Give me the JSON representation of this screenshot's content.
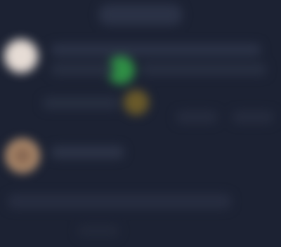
{
  "header": {
    "title": ""
  },
  "items": [
    {
      "name": "",
      "preview": "",
      "meta": ""
    },
    {
      "name": "",
      "preview": ""
    }
  ],
  "footer": {
    "text": ""
  },
  "colors": {
    "background": "#1c2233",
    "online": "#2f8f45",
    "away": "#6a5a2a"
  }
}
